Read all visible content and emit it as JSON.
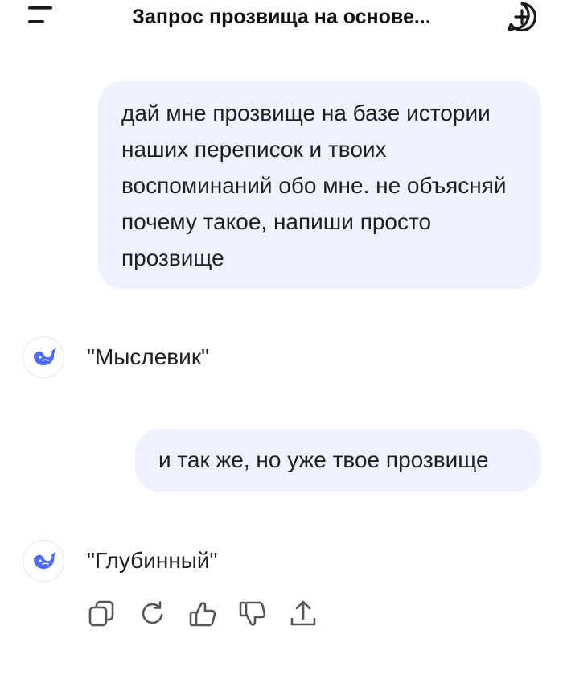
{
  "header": {
    "title": "Запрос прозвища на основе...",
    "menu_icon": "menu-icon",
    "new_chat_icon": "plus-circle-icon"
  },
  "messages": [
    {
      "role": "user",
      "text": "дай мне прозвище на базе истории наших переписок и твоих воспоминаний обо мне. не объясняй почему такое, напиши просто прозвище"
    },
    {
      "role": "assistant",
      "text": "\"Мыслевик\""
    },
    {
      "role": "user",
      "text": "и так же, но уже твое прозвище"
    },
    {
      "role": "assistant",
      "text": "\"Глубинный\""
    }
  ],
  "assistant_avatar_icon": "whale-logo-icon",
  "actions": [
    "copy-icon",
    "regenerate-icon",
    "thumbs-up-icon",
    "thumbs-down-icon",
    "share-icon"
  ],
  "colors": {
    "user_bubble": "#edf2fd",
    "accent": "#4d6bfe",
    "icon_gray": "#555555",
    "text": "#1f1f1f"
  }
}
